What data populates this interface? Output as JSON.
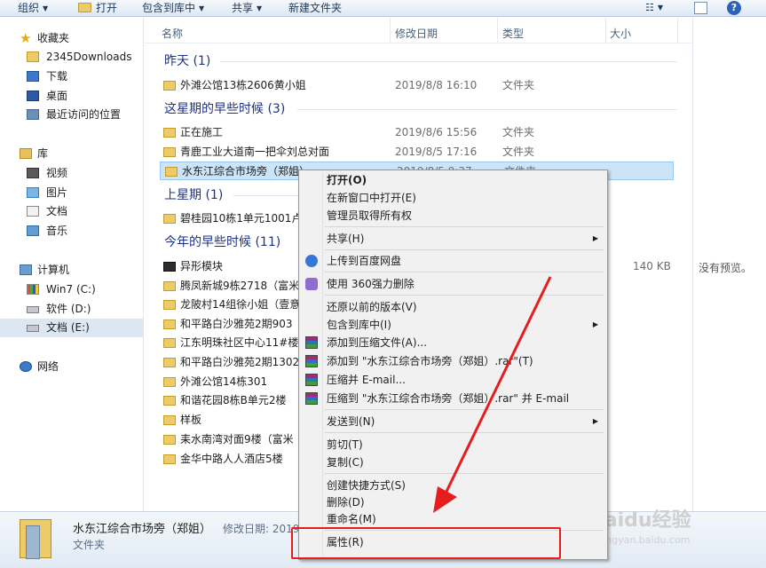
{
  "toolbar": {
    "organize": "组织",
    "open": "打开",
    "include_library": "包含到库中",
    "share": "共享",
    "new_folder": "新建文件夹"
  },
  "sidebar": {
    "favorites": "收藏夹",
    "fav_items": [
      "2345Downloads",
      "下载",
      "桌面",
      "最近访问的位置"
    ],
    "libraries": "库",
    "lib_items": [
      "视频",
      "图片",
      "文档",
      "音乐"
    ],
    "computer": "计算机",
    "drives": [
      "Win7 (C:)",
      "软件 (D:)",
      "文档 (E:)"
    ],
    "network": "网络"
  },
  "columns": {
    "name": "名称",
    "date": "修改日期",
    "type": "类型",
    "size": "大小"
  },
  "groups": {
    "yesterday": "昨天 (1)",
    "this_week": "这星期的早些时候 (3)",
    "last_week": "上星期 (1)",
    "this_year": "今年的早些时候 (11)"
  },
  "rows": {
    "r1": {
      "name": "外滩公馆13栋2606黄小姐",
      "date": "2019/8/8 16:10",
      "type": "文件夹"
    },
    "r2": {
      "name": "正在施工",
      "date": "2019/8/6 15:56",
      "type": "文件夹"
    },
    "r3": {
      "name": "青鹿工业大道南一把伞刘总对面",
      "date": "2019/8/5 17:16",
      "type": "文件夹"
    },
    "r4": {
      "name": "水东江综合市场旁（郑姐）",
      "date": "2019/8/5 9:37",
      "type": "文件夹"
    },
    "r5": {
      "name": "碧桂园10栋1单元1001卢"
    },
    "r6": {
      "name": "异形模块",
      "size": "140 KB"
    },
    "r7": {
      "name": "腾凤新城9栋2718（富米"
    },
    "r8": {
      "name": "龙陂村14组徐小姐（壹意"
    },
    "r9": {
      "name": "和平路白沙雅苑2期903"
    },
    "r10": {
      "name": "江东明珠社区中心11#楼"
    },
    "r11": {
      "name": "和平路白沙雅苑2期1302"
    },
    "r12": {
      "name": "外滩公馆14栋301"
    },
    "r13": {
      "name": "和谐花园8栋B单元2楼"
    },
    "r14": {
      "name": "样板"
    },
    "r15": {
      "name": "耒水南湾对面9楼（富米"
    },
    "r16": {
      "name": "金华中路人人酒店5楼"
    }
  },
  "preview": {
    "text": "没有预览。"
  },
  "details": {
    "name": "水东江综合市场旁（郑姐）",
    "modified_label": "修改日期: 2019",
    "type": "文件夹"
  },
  "context_menu": {
    "open": "打开(O)",
    "open_new_window": "在新窗口中打开(E)",
    "take_ownership": "管理员取得所有权",
    "share": "共享(H)",
    "upload_baidu": "上传到百度网盘",
    "delete_360": "使用 360强力删除",
    "restore_versions": "还原以前的版本(V)",
    "include_library": "包含到库中(I)",
    "add_archive": "添加到压缩文件(A)...",
    "add_to_rar": "添加到 \"水东江综合市场旁（郑姐）.rar\"(T)",
    "compress_email": "压缩并 E-mail...",
    "compress_rar_email": "压缩到 \"水东江综合市场旁（郑姐）.rar\" 并 E-mail",
    "send_to": "发送到(N)",
    "cut": "剪切(T)",
    "copy": "复制(C)",
    "create_shortcut": "创建快捷方式(S)",
    "delete": "删除(D)",
    "rename": "重命名(M)",
    "properties": "属性(R)"
  },
  "watermark": {
    "brand": "Baidu经验",
    "url": "jingyan.baidu.com"
  },
  "colors": {
    "group_header": "#1e3287",
    "selection": "#cce4f7",
    "highlight": "#e51d1d"
  }
}
